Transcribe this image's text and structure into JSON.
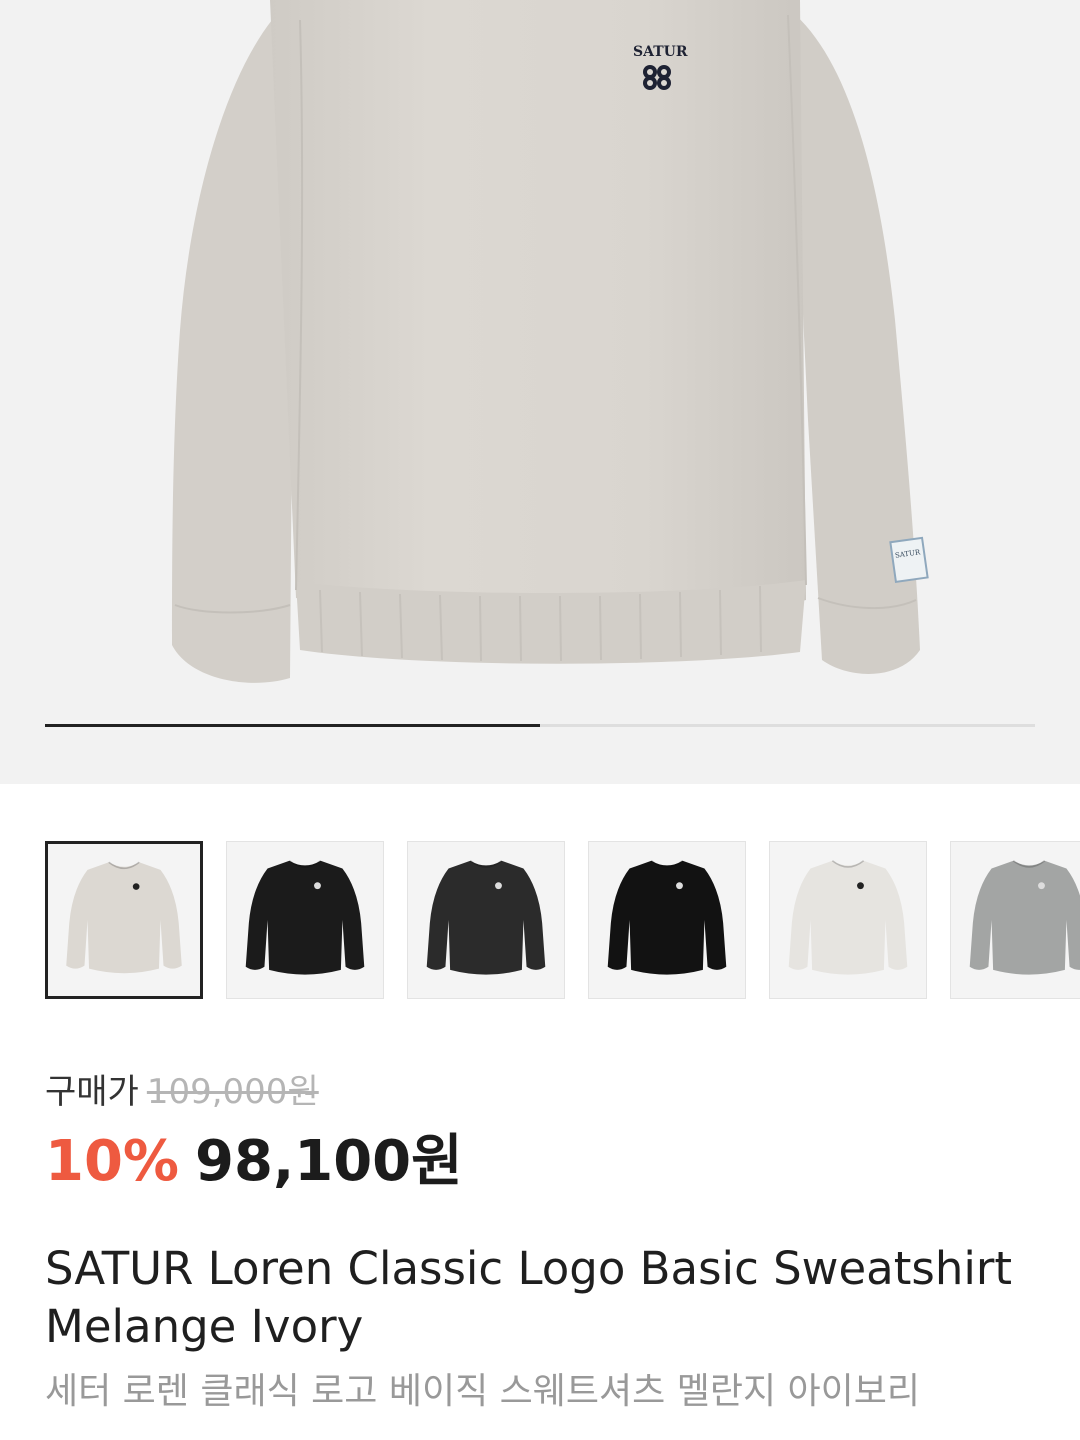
{
  "product": {
    "main_image_alt": "SATUR sweatshirt melange ivory",
    "logo_text": "SATUR",
    "cuff_label_text": "SATUR",
    "gallery_progress_percent": 50,
    "thumbnails": [
      {
        "color_name": "melange ivory",
        "fill": "#dcd8d2",
        "selected": true
      },
      {
        "color_name": "black",
        "fill": "#1b1b1b",
        "selected": false
      },
      {
        "color_name": "charcoal",
        "fill": "#2b2b2b",
        "selected": false
      },
      {
        "color_name": "black",
        "fill": "#121212",
        "selected": false
      },
      {
        "color_name": "light gray",
        "fill": "#e6e4e0",
        "selected": false
      },
      {
        "color_name": "melange gray",
        "fill": "#a3a5a4",
        "selected": false
      }
    ],
    "price_label": "구매가",
    "original_price": "109,000원",
    "discount_rate": "10%",
    "final_price": "98,100원",
    "title_en": "SATUR Loren Classic Logo Basic Sweatshirt Melange Ivory",
    "title_ko": "세터 로렌 클래식 로고 베이직 스웨트셔츠 멜란지 아이보리"
  },
  "colors": {
    "discount": "#ee5a40",
    "hero_background": "#f2f2f2",
    "text_primary": "#1f1f1f",
    "text_secondary": "#999999"
  }
}
